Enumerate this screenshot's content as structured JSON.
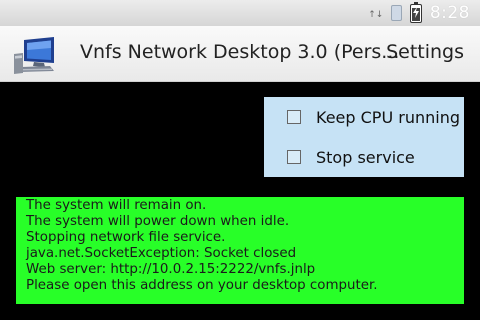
{
  "status_bar": {
    "time": "8:28",
    "icons": [
      "signal-icon",
      "sim-icon",
      "battery-charging-icon"
    ],
    "signal_text": "↑↓"
  },
  "title_bar": {
    "app_title": "Vnfs Network Desktop 3.0 (Pers...",
    "settings_label": "Settings",
    "app_icon": "computer-monitor-icon"
  },
  "options": {
    "items": [
      {
        "label": "Keep CPU running",
        "checked": false
      },
      {
        "label": "Stop service",
        "checked": false
      }
    ],
    "background": "#c6e2f5"
  },
  "log": {
    "background": "#28ff28",
    "lines": [
      "The system will remain on.",
      "The system will power down when idle.",
      "Stopping network file service.",
      "java.net.SocketException: Socket closed",
      "Web server: http://10.0.2.15:2222/vnfs.jnlp",
      "Please open this address on your desktop computer."
    ]
  }
}
